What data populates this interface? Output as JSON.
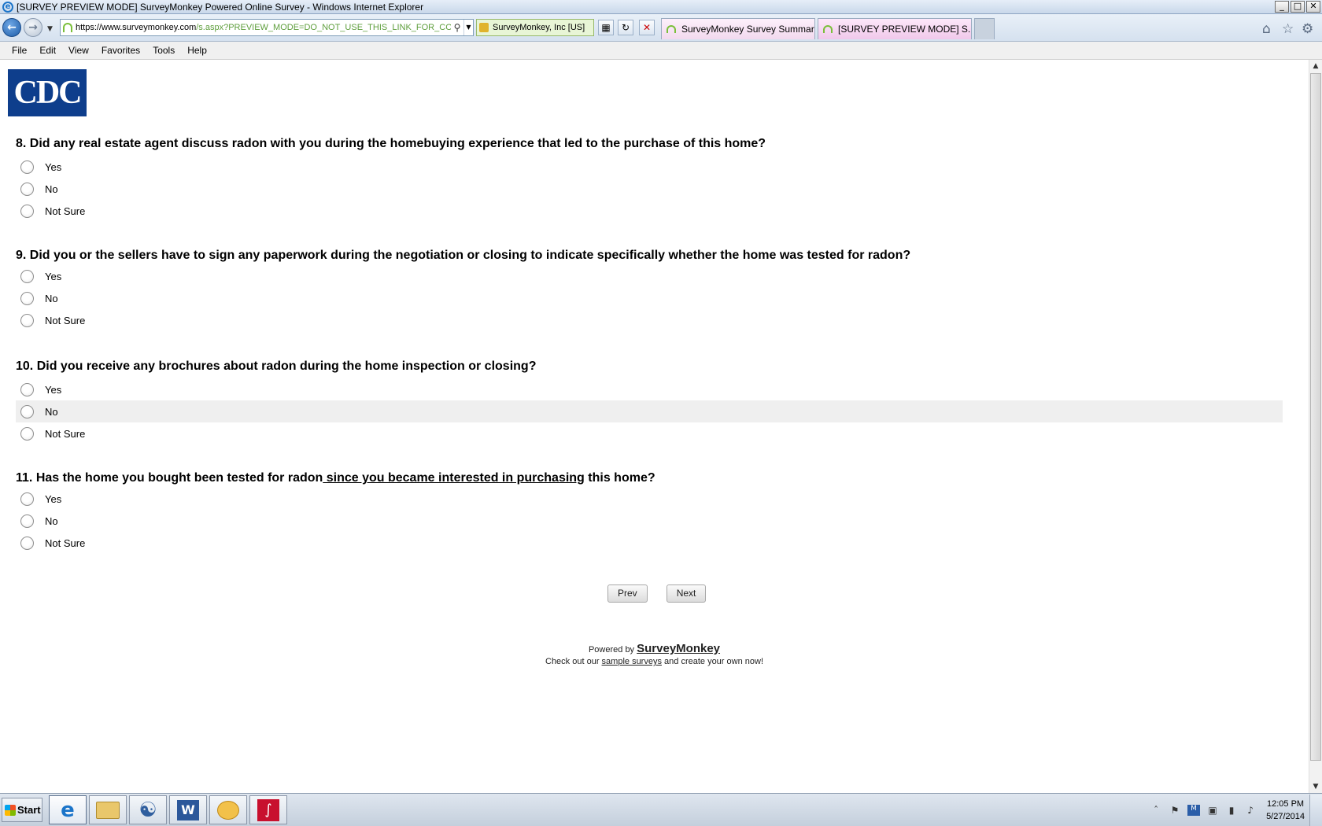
{
  "window": {
    "title": "[SURVEY PREVIEW MODE] SurveyMonkey Powered Online Survey - Windows Internet Explorer",
    "controls": [
      "_",
      "□",
      "✕"
    ]
  },
  "nav": {
    "back_icon": "back-arrow-icon",
    "forward_icon": "forward-arrow-icon",
    "address": "https://www.surveymonkey.com/s.aspx?PREVIEW_MODE=DO_NOT_USE_THIS_LINK_FOR_COLL",
    "address_host": "https://www.surveymonkey.com",
    "address_path": "/s.aspx?PREVIEW_MODE=DO_NOT_USE_THIS_LINK_FOR_COLL",
    "certificate": "SurveyMonkey, Inc [US]",
    "tabs": [
      {
        "label": "SurveyMonkey Survey Summar..."
      },
      {
        "label": "[SURVEY PREVIEW MODE] S..."
      }
    ]
  },
  "menu": {
    "items": [
      "File",
      "Edit",
      "View",
      "Favorites",
      "Tools",
      "Help"
    ]
  },
  "logo": {
    "text": "CDC"
  },
  "questions": [
    {
      "number": "8.",
      "text": "Did any real estate agent discuss radon with you during the homebuying experience that led to the purchase of this home?",
      "options": [
        "Yes",
        "No",
        "Not Sure"
      ]
    },
    {
      "number": "9.",
      "text": "Did you or the sellers have to sign any paperwork during the negotiation or closing to indicate specifically whether the home was tested for radon?",
      "options": [
        "Yes",
        "No",
        "Not Sure"
      ]
    },
    {
      "number": "10.",
      "text": "Did you receive any brochures about radon during the home inspection or closing?",
      "options": [
        "Yes",
        "No",
        "Not Sure"
      ]
    },
    {
      "number": "11.",
      "text_before": "Has the home you bought been tested for radon",
      "text_underlined": " since you became interested in purchasing",
      "text_after": " this home?",
      "options": [
        "Yes",
        "No",
        "Not Sure"
      ]
    }
  ],
  "buttons": {
    "prev": "Prev",
    "next": "Next"
  },
  "footer": {
    "powered_by": "Powered by",
    "brand": "SurveyMonkey",
    "line2_before": "Check out our",
    "line2_link": "sample surveys",
    "line2_after": "and create your own now!"
  },
  "taskbar": {
    "start": "Start",
    "apps": [
      "internet-explorer-icon",
      "file-explorer-icon",
      "globe-icon",
      "word-icon",
      "outlook-icon",
      "acrobat-icon"
    ],
    "time": "12:05 PM",
    "date": "5/27/2014"
  }
}
